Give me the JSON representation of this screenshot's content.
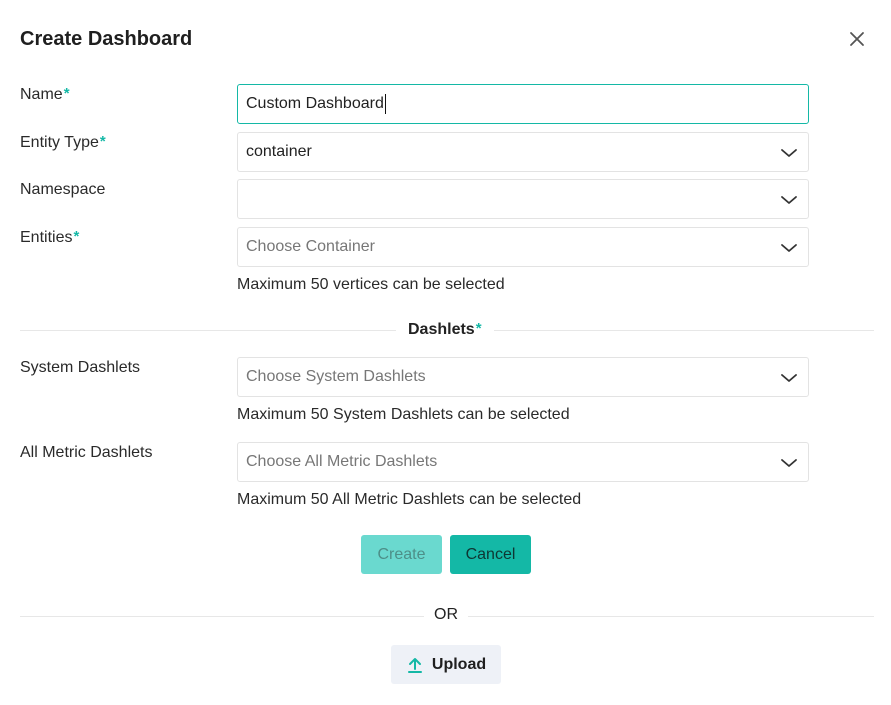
{
  "dialog": {
    "title": "Create Dashboard"
  },
  "form": {
    "name": {
      "label": "Name",
      "required_mark": "*",
      "value": "Custom Dashboard"
    },
    "entity_type": {
      "label": "Entity Type",
      "required_mark": "*",
      "value": "container"
    },
    "namespace": {
      "label": "Namespace",
      "value": ""
    },
    "entities": {
      "label": "Entities",
      "required_mark": "*",
      "placeholder": "Choose Container",
      "hint": "Maximum 50 vertices can be selected"
    }
  },
  "dashlets": {
    "section_label": "Dashlets",
    "required_mark": "*",
    "system": {
      "label": "System Dashlets",
      "placeholder": "Choose System Dashlets",
      "hint": "Maximum 50 System Dashlets can be selected"
    },
    "all_metric": {
      "label": "All Metric Dashlets",
      "placeholder": "Choose All Metric Dashlets",
      "hint": "Maximum 50 All Metric Dashlets can be selected"
    }
  },
  "actions": {
    "create_label": "Create",
    "cancel_label": "Cancel",
    "or_label": "OR",
    "upload_label": "Upload"
  },
  "colors": {
    "accent": "#14b8a6",
    "accent_disabled": "#6ad9cf",
    "upload_bg": "#eef1f7"
  },
  "icons": {
    "close": "close-icon",
    "dropdown": "chevron-down-icon",
    "upload": "upload-arrow-icon"
  }
}
